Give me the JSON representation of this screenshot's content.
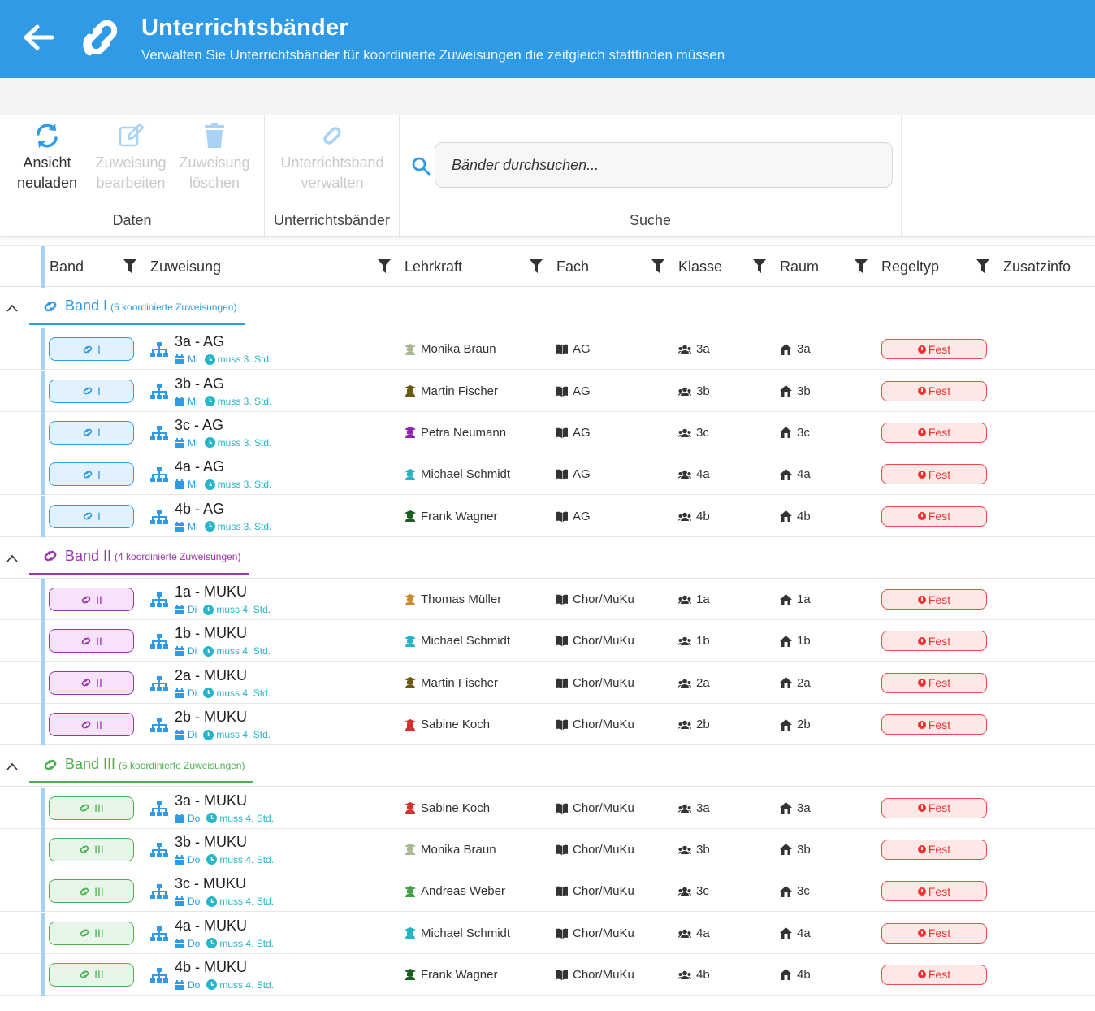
{
  "header": {
    "title": "Unterrichtsbänder",
    "subtitle": "Verwalten Sie Unterrichtsbänder für koordinierte Zuweisungen die zeitgleich stattfinden müssen"
  },
  "ribbon": {
    "groups": {
      "daten": "Daten",
      "unterrichtsbaender": "Unterrichtsbänder",
      "suche": "Suche"
    },
    "buttons": {
      "reload_1": "Ansicht",
      "reload_2": "neuladen",
      "edit_1": "Zuweisung",
      "edit_2": "bearbeiten",
      "delete_1": "Zuweisung",
      "delete_2": "löschen",
      "manage_1": "Unterrichtsband",
      "manage_2": "verwalten"
    },
    "search_placeholder": "Bänder durchsuchen..."
  },
  "columns": {
    "band": "Band",
    "zuweisung": "Zuweisung",
    "lehrkraft": "Lehrkraft",
    "fach": "Fach",
    "klasse": "Klasse",
    "raum": "Raum",
    "regeltyp": "Regeltyp",
    "zusatzinfo": "Zusatzinfo"
  },
  "colors": {
    "header_blue": "#2f9be6",
    "band1": "#2f9be6",
    "band2": "#9b35b0",
    "band3": "#4caf50",
    "fest_red": "#e33333"
  },
  "groups": [
    {
      "name": "Band I",
      "count": "(5 koordinierte Zuweisungen)",
      "color": "#2f9be6",
      "chip_label": "I",
      "chip_bg": "#e3f1fc",
      "rows": [
        {
          "title": "3a - AG",
          "day": "Mi",
          "rule": "muss 3. Std.",
          "teacher": "Monika Braun",
          "teacher_color": "#a8b890",
          "subject": "AG",
          "klasse": "3a",
          "raum": "3a",
          "regel": "Fest"
        },
        {
          "title": "3b - AG",
          "day": "Mi",
          "rule": "muss 3. Std.",
          "teacher": "Martin Fischer",
          "teacher_color": "#6b5a10",
          "subject": "AG",
          "klasse": "3b",
          "raum": "3b",
          "regel": "Fest"
        },
        {
          "title": "3c - AG",
          "day": "Mi",
          "rule": "muss 3. Std.",
          "teacher": "Petra Neumann",
          "teacher_color": "#8e24aa",
          "subject": "AG",
          "klasse": "3c",
          "raum": "3c",
          "regel": "Fest"
        },
        {
          "title": "4a - AG",
          "day": "Mi",
          "rule": "muss 3. Std.",
          "teacher": "Michael Schmidt",
          "teacher_color": "#26b5c5",
          "subject": "AG",
          "klasse": "4a",
          "raum": "4a",
          "regel": "Fest"
        },
        {
          "title": "4b - AG",
          "day": "Mi",
          "rule": "muss 3. Std.",
          "teacher": "Frank Wagner",
          "teacher_color": "#1b5e20",
          "subject": "AG",
          "klasse": "4b",
          "raum": "4b",
          "regel": "Fest"
        }
      ]
    },
    {
      "name": "Band II",
      "count": "(4 koordinierte Zuweisungen)",
      "color": "#9b35b0",
      "chip_label": "II",
      "chip_bg": "#f6e3fa",
      "rows": [
        {
          "title": "1a - MUKU",
          "day": "Di",
          "rule": "muss 4. Std.",
          "teacher": "Thomas Müller",
          "teacher_color": "#c98a2e",
          "subject": "Chor/MuKu",
          "klasse": "1a",
          "raum": "1a",
          "regel": "Fest"
        },
        {
          "title": "1b - MUKU",
          "day": "Di",
          "rule": "muss 4. Std.",
          "teacher": "Michael Schmidt",
          "teacher_color": "#26b5c5",
          "subject": "Chor/MuKu",
          "klasse": "1b",
          "raum": "1b",
          "regel": "Fest"
        },
        {
          "title": "2a - MUKU",
          "day": "Di",
          "rule": "muss 4. Std.",
          "teacher": "Martin Fischer",
          "teacher_color": "#6b5a10",
          "subject": "Chor/MuKu",
          "klasse": "2a",
          "raum": "2a",
          "regel": "Fest"
        },
        {
          "title": "2b - MUKU",
          "day": "Di",
          "rule": "muss 4. Std.",
          "teacher": "Sabine Koch",
          "teacher_color": "#d32f2f",
          "subject": "Chor/MuKu",
          "klasse": "2b",
          "raum": "2b",
          "regel": "Fest"
        }
      ]
    },
    {
      "name": "Band III",
      "count": "(5 koordinierte Zuweisungen)",
      "color": "#4caf50",
      "chip_label": "III",
      "chip_bg": "#e8f5e9",
      "rows": [
        {
          "title": "3a - MUKU",
          "day": "Do",
          "rule": "muss 4. Std.",
          "teacher": "Sabine Koch",
          "teacher_color": "#d32f2f",
          "subject": "Chor/MuKu",
          "klasse": "3a",
          "raum": "3a",
          "regel": "Fest"
        },
        {
          "title": "3b - MUKU",
          "day": "Do",
          "rule": "muss 4. Std.",
          "teacher": "Monika Braun",
          "teacher_color": "#a8b890",
          "subject": "Chor/MuKu",
          "klasse": "3b",
          "raum": "3b",
          "regel": "Fest"
        },
        {
          "title": "3c - MUKU",
          "day": "Do",
          "rule": "muss 4. Std.",
          "teacher": "Andreas Weber",
          "teacher_color": "#43a047",
          "subject": "Chor/MuKu",
          "klasse": "3c",
          "raum": "3c",
          "regel": "Fest"
        },
        {
          "title": "4a - MUKU",
          "day": "Do",
          "rule": "muss 4. Std.",
          "teacher": "Michael Schmidt",
          "teacher_color": "#26b5c5",
          "subject": "Chor/MuKu",
          "klasse": "4a",
          "raum": "4a",
          "regel": "Fest"
        },
        {
          "title": "4b - MUKU",
          "day": "Do",
          "rule": "muss 4. Std.",
          "teacher": "Frank Wagner",
          "teacher_color": "#1b5e20",
          "subject": "Chor/MuKu",
          "klasse": "4b",
          "raum": "4b",
          "regel": "Fest"
        }
      ]
    }
  ]
}
